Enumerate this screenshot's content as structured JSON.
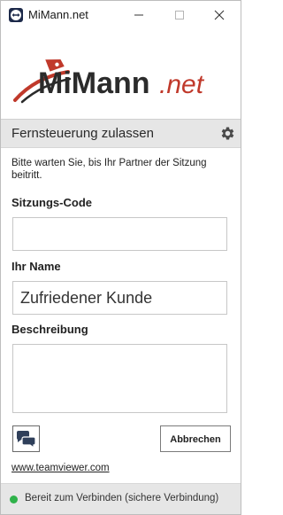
{
  "window": {
    "title": "MiMann.net",
    "app_icon": "teamviewer-arrows-icon",
    "controls": [
      "minimize-icon",
      "maximize-icon",
      "close-icon"
    ]
  },
  "logo": {
    "text_left": "MiMann",
    "text_right": ".net",
    "colors": {
      "dark": "#2b2b2b",
      "accent": "#c0392b"
    }
  },
  "section": {
    "title": "Fernsteuerung zulassen",
    "settings_icon": "gear-icon"
  },
  "hint": "Bitte warten Sie, bis Ihr Partner der Sitzung beitritt.",
  "fields": {
    "session_code_label": "Sitzungs-Code",
    "session_code_value": "",
    "name_label": "Ihr Name",
    "name_value": "Zufriedener Kunde",
    "description_label": "Beschreibung",
    "description_value": ""
  },
  "actions": {
    "chat_icon": "chat-icon",
    "cancel_label": "Abbrechen"
  },
  "footer_link": "www.teamviewer.com",
  "status": {
    "text": "Bereit zum Verbinden (sichere Verbindung)",
    "color": "#2fb24a"
  }
}
